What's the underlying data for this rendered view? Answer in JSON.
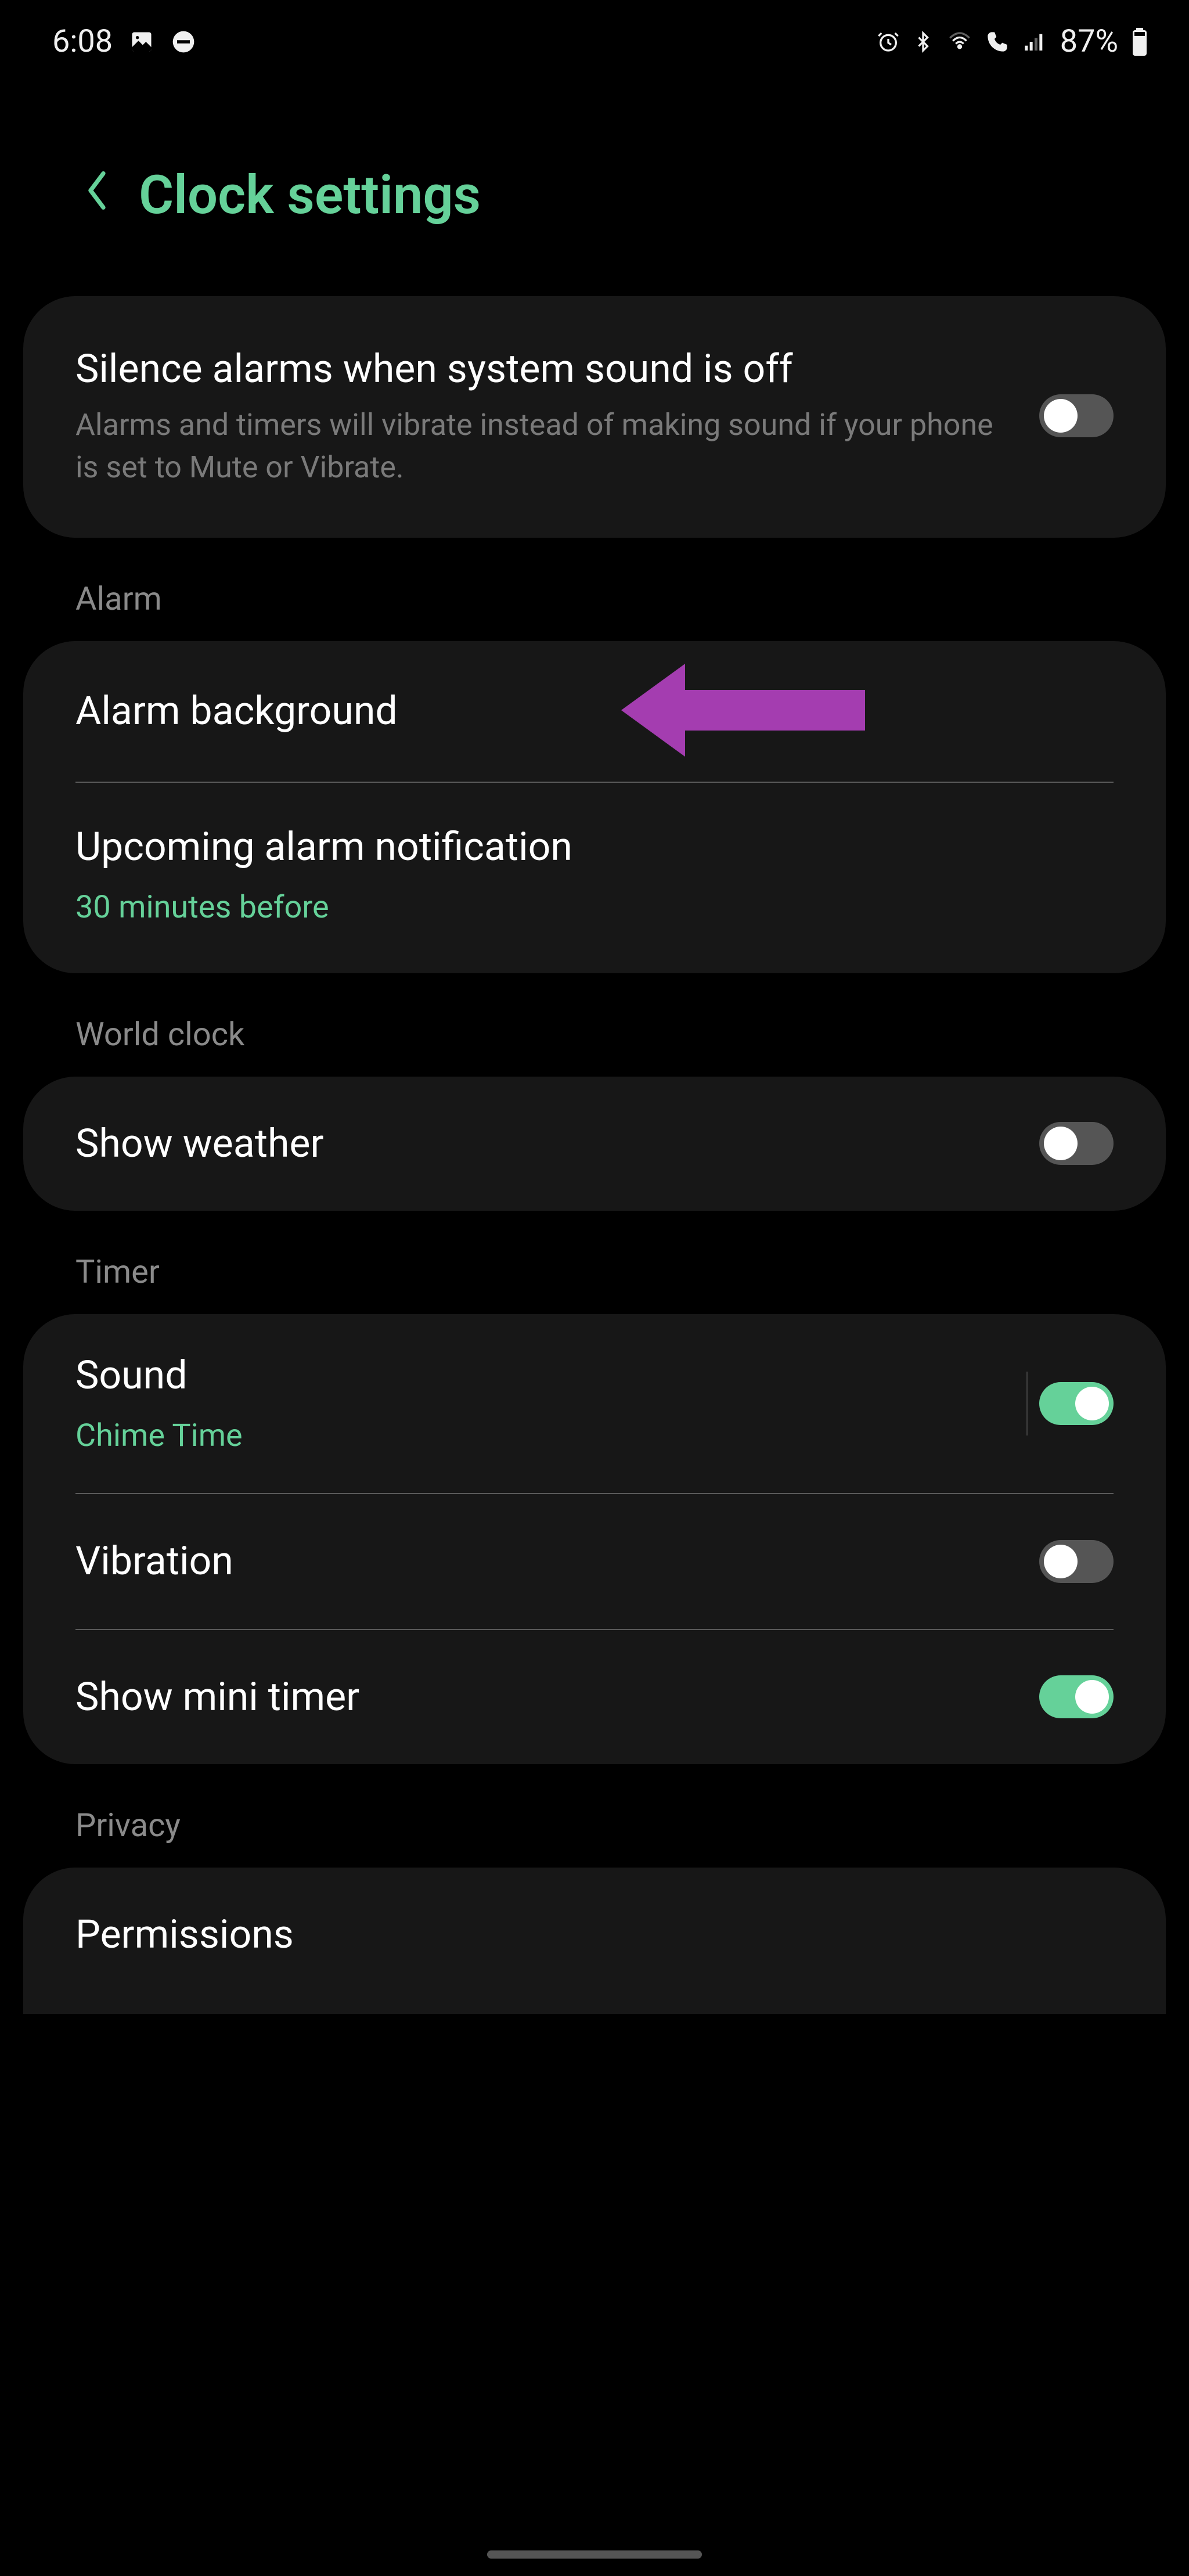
{
  "statusBar": {
    "time": "6:08",
    "battery": "87%"
  },
  "header": {
    "title": "Clock settings"
  },
  "sections": {
    "top": {
      "silenceAlarms": {
        "title": "Silence alarms when system sound is off",
        "subtitle": "Alarms and timers will vibrate instead of making sound if your phone is set to Mute or Vibrate.",
        "toggled": false
      }
    },
    "alarm": {
      "label": "Alarm",
      "alarmBackground": {
        "title": "Alarm background"
      },
      "upcomingNotification": {
        "title": "Upcoming alarm notification",
        "subtitle": "30 minutes before"
      }
    },
    "worldClock": {
      "label": "World clock",
      "showWeather": {
        "title": "Show weather",
        "toggled": false
      }
    },
    "timer": {
      "label": "Timer",
      "sound": {
        "title": "Sound",
        "subtitle": "Chime Time",
        "toggled": true
      },
      "vibration": {
        "title": "Vibration",
        "toggled": false
      },
      "showMiniTimer": {
        "title": "Show mini timer",
        "toggled": true
      }
    },
    "privacy": {
      "label": "Privacy",
      "permissions": {
        "title": "Permissions"
      }
    }
  }
}
